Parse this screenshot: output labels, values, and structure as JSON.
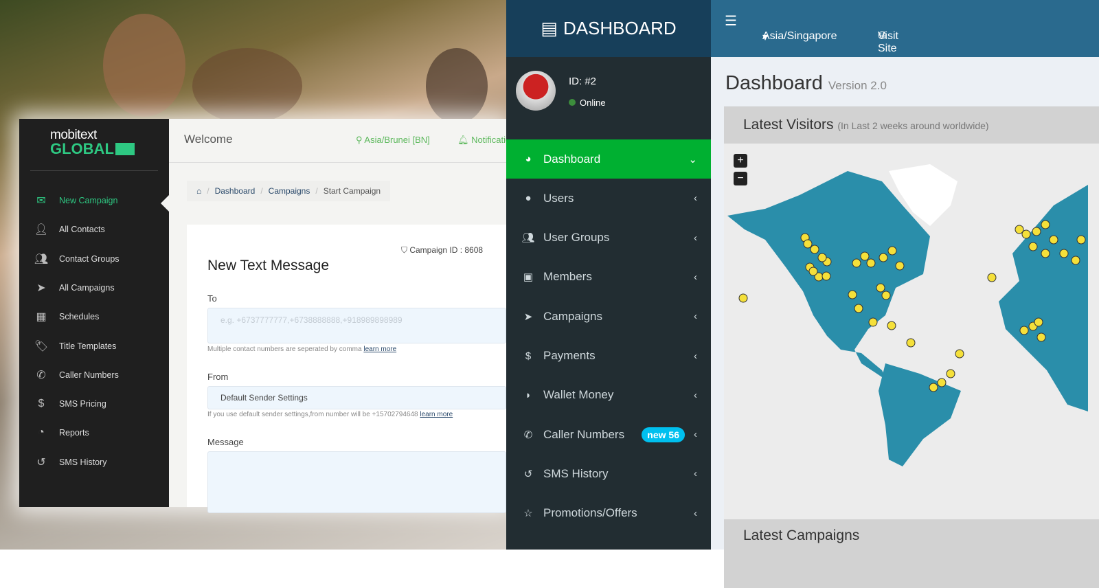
{
  "left_app": {
    "logo": {
      "line1": "mobitext",
      "line2": "GLOBAL"
    },
    "header": {
      "welcome": "Welcome",
      "timezone": "Asia/Brunei [BN]",
      "notifications": "Notifications"
    },
    "sidebar": [
      {
        "label": "New Campaign",
        "icon": "envelope"
      },
      {
        "label": "All Contacts",
        "icon": "user-plus"
      },
      {
        "label": "Contact Groups",
        "icon": "users"
      },
      {
        "label": "All Campaigns",
        "icon": "paper-plane"
      },
      {
        "label": "Schedules",
        "icon": "calendar-plus"
      },
      {
        "label": "Title Templates",
        "icon": "tags"
      },
      {
        "label": "Caller Numbers",
        "icon": "phone"
      },
      {
        "label": "SMS Pricing",
        "icon": "dollar"
      },
      {
        "label": "Reports",
        "icon": "pie-chart"
      },
      {
        "label": "SMS History",
        "icon": "history"
      }
    ],
    "breadcrumb": [
      "Dashboard",
      "Campaigns",
      "Start Campaign"
    ],
    "form": {
      "campaign_id": "Campaign ID : 8608",
      "title": "New Text Message",
      "to_label": "To",
      "to_placeholder": "e.g. +6737777777,+6738888888,+918989898989",
      "to_help": "Multiple contact numbers are seperated by comma",
      "learn_more": "learn more",
      "from_label": "From",
      "from_value": "Default Sender Settings",
      "from_help": "If you use default sender settings,from number will be +15702794648",
      "message_label": "Message"
    }
  },
  "right_app": {
    "logo": "DASHBOARD",
    "header": {
      "timezone": "Asia/Singapore",
      "visit_site": "Visit Site"
    },
    "user": {
      "id": "ID: #2",
      "status": "Online"
    },
    "sidebar": [
      {
        "label": "Dashboard",
        "icon": "dashboard",
        "chev": "⌄"
      },
      {
        "label": "Users",
        "icon": "user",
        "chev": "‹"
      },
      {
        "label": "User Groups",
        "icon": "users",
        "chev": "‹"
      },
      {
        "label": "Members",
        "icon": "briefcase",
        "chev": "‹"
      },
      {
        "label": "Campaigns",
        "icon": "paper-plane",
        "chev": "‹"
      },
      {
        "label": "Payments",
        "icon": "dollar",
        "chev": "‹"
      },
      {
        "label": "Wallet Money",
        "icon": "wallet",
        "chev": "‹"
      },
      {
        "label": "Caller Numbers",
        "icon": "phone",
        "chev": "‹",
        "badge": "new 56"
      },
      {
        "label": "SMS History",
        "icon": "history",
        "chev": "‹"
      },
      {
        "label": "Promotions/Offers",
        "icon": "star",
        "chev": "‹"
      }
    ],
    "page_title": "Dashboard",
    "page_version": "Version 2.0",
    "visitors": {
      "title": "Latest Visitors",
      "subtitle": "(In Last 2 weeks around worldwide)",
      "zoom_in": "+",
      "zoom_out": "−"
    },
    "campaigns_title": "Latest Campaigns",
    "colors": {
      "active": "#00b031",
      "map_land": "#2a8eaa",
      "marker": "#f5e03a"
    }
  }
}
